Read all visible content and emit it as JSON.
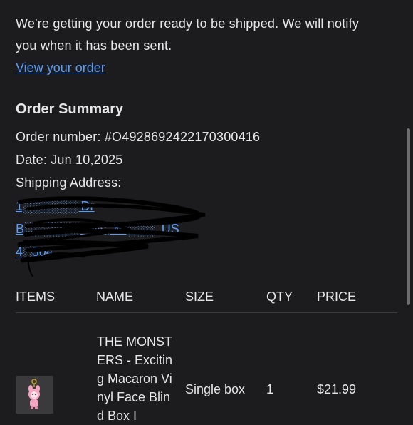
{
  "intro": {
    "line1": "We're getting your order ready to be shipped. We will notify",
    "line2": "you when it has been sent.",
    "view_order_link": "View your order"
  },
  "summary": {
    "title": "Order Summary",
    "order_number_label": "Order number: #O4928692422170300416",
    "date_label": "Date: Jun 10,2025",
    "shipping_label": "Shipping Address:",
    "address_line1": "1░░░░░░ Dr",
    "address_line2": "B░░░░░░ Hills, Mi░░░, US",
    "address_line3": "4░304"
  },
  "table": {
    "headers": [
      "ITEMS",
      "NAME",
      "SIZE",
      "QTY",
      "PRICE"
    ],
    "rows": [
      {
        "name": "THE MONSTERS - Exciting Macaron Vinyl Face Blind Box I",
        "size": "Single box",
        "qty": "1",
        "price": "$21.99",
        "thumb_icon": "plush-keychain-icon"
      }
    ]
  },
  "colors": {
    "background": "#1c1c1e",
    "text": "#e6e6e8",
    "link": "#5b9cf5",
    "divider": "#3a3a3c"
  }
}
